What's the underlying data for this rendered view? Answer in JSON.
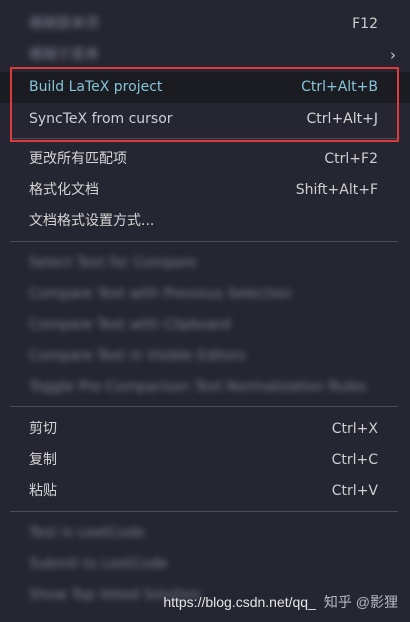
{
  "menu": {
    "items": [
      {
        "label": "模糊菜单项",
        "shortcut": "F12"
      },
      {
        "label": "模糊子菜单",
        "chevron": "›"
      },
      {
        "label": "Build LaTeX project",
        "shortcut": "Ctrl+Alt+B"
      },
      {
        "label": "SyncTeX from cursor",
        "shortcut": "Ctrl+Alt+J"
      },
      {
        "label": "更改所有匹配项",
        "shortcut": "Ctrl+F2"
      },
      {
        "label": "格式化文档",
        "shortcut": "Shift+Alt+F"
      },
      {
        "label": "文档格式设置方式..."
      },
      {
        "label": "Select Text for Compare"
      },
      {
        "label": "Compare Text with Previous Selection"
      },
      {
        "label": "Compare Text with Clipboard"
      },
      {
        "label": "Compare Text in Visible Editors"
      },
      {
        "label": "Toggle Pre-Comparison Text Normalization Rules"
      },
      {
        "label": "剪切",
        "shortcut": "Ctrl+X"
      },
      {
        "label": "复制",
        "shortcut": "Ctrl+C"
      },
      {
        "label": "粘贴",
        "shortcut": "Ctrl+V"
      },
      {
        "label": "Test in LeetCode"
      },
      {
        "label": "Submit to LeetCode"
      },
      {
        "label": "Show Top Voted Solution"
      }
    ]
  },
  "watermark": {
    "url": "https://blog.csdn.net/qq_",
    "author": "知乎 @影狸"
  },
  "colors": {
    "background": "#252631",
    "highlight_text": "#86c5da",
    "red_box": "#e03b3b"
  }
}
